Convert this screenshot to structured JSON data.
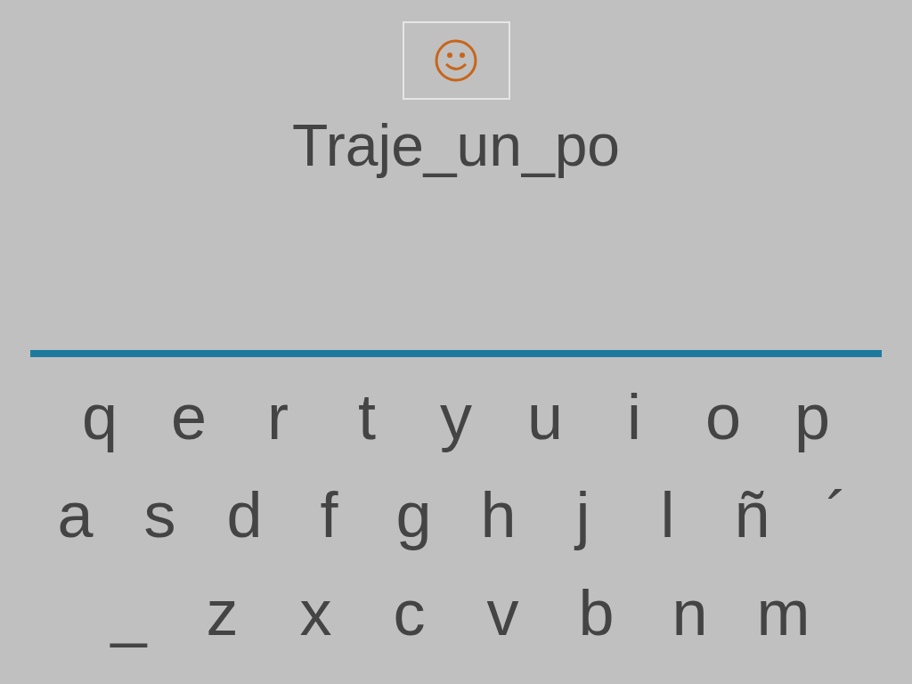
{
  "word": "Traje_un_po",
  "keyboard": {
    "rows": [
      [
        "q",
        "e",
        "r",
        "t",
        "y",
        "u",
        "i",
        "o",
        "p"
      ],
      [
        "a",
        "s",
        "d",
        "f",
        "g",
        "h",
        "j",
        "l",
        "ñ",
        "´"
      ],
      [
        "_",
        "z",
        "x",
        "c",
        "v",
        "b",
        "n",
        "m"
      ]
    ]
  }
}
